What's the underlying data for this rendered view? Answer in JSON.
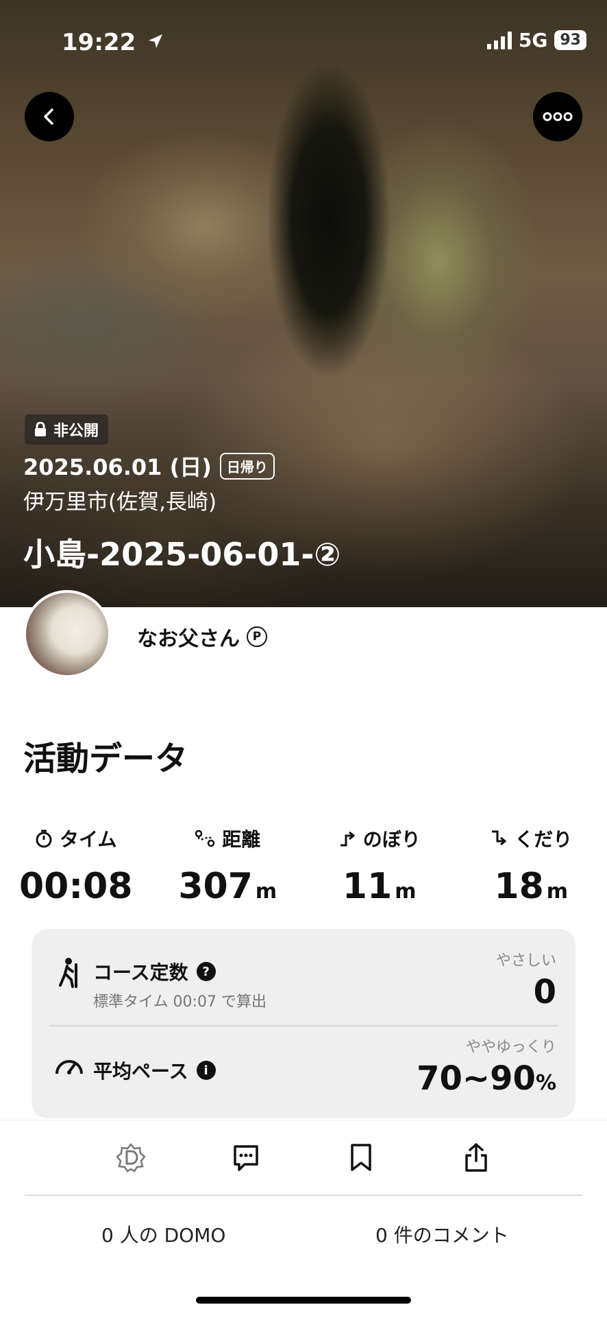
{
  "status_bar": {
    "time": "19:22",
    "network": "5G",
    "battery": "93"
  },
  "hero": {
    "privacy": "非公開",
    "date": "2025.06.01 (日)",
    "trip_type": "日帰り",
    "location": "伊万里市(佐賀,長崎)",
    "title": "小島-2025-06-01-②"
  },
  "user": {
    "name": "なお父さん",
    "badge": "P"
  },
  "activity": {
    "section_title": "活動データ",
    "stats": [
      {
        "label": "タイム",
        "value": "00:08",
        "unit": ""
      },
      {
        "label": "距離",
        "value": "307",
        "unit": "m"
      },
      {
        "label": "のぼり",
        "value": "11",
        "unit": "m"
      },
      {
        "label": "くだり",
        "value": "18",
        "unit": "m"
      }
    ],
    "course": {
      "label": "コース定数",
      "sub": "標準タイム 00:07 で算出",
      "rating": "やさしい",
      "value": "0"
    },
    "pace": {
      "label": "平均ペース",
      "rating": "ややゆっくり",
      "value": "70~90",
      "unit": "%"
    }
  },
  "footer": {
    "domo_count": "0 人の DOMO",
    "comment_count": "0 件のコメント"
  },
  "icons": [
    "back-icon",
    "more-icon",
    "lock-icon",
    "timer-icon",
    "route-icon",
    "ascent-icon",
    "descent-icon",
    "hiker-icon",
    "question-icon",
    "gauge-icon",
    "info-icon",
    "domo-icon",
    "comment-icon",
    "bookmark-icon",
    "share-icon"
  ]
}
